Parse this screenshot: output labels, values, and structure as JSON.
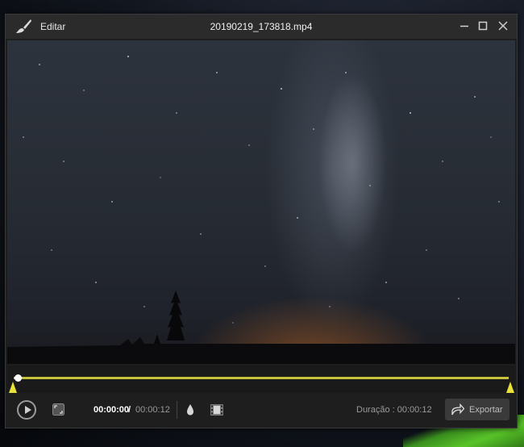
{
  "window": {
    "menu_label": "Editar",
    "title": "20190219_173818.mp4"
  },
  "player": {
    "current_time": "00:00:00",
    "separator": "/",
    "total_time": "00:00:12",
    "duration_text": "Duração : 00:00:12",
    "export_label": "Exportar",
    "playhead_progress": 0.0
  },
  "icons": {
    "brush": "paint-brush-icon",
    "minimize": "minimize-icon",
    "maximize": "maximize-icon",
    "close": "close-icon",
    "play": "play-icon",
    "fullscreen": "fullscreen-icon",
    "drop": "water-drop-icon",
    "film": "film-strip-icon",
    "export": "share-arrow-icon"
  },
  "colors": {
    "accent": "#e8e23a",
    "titlebar": "#2b2b2b",
    "panel": "#1e1e1e"
  }
}
